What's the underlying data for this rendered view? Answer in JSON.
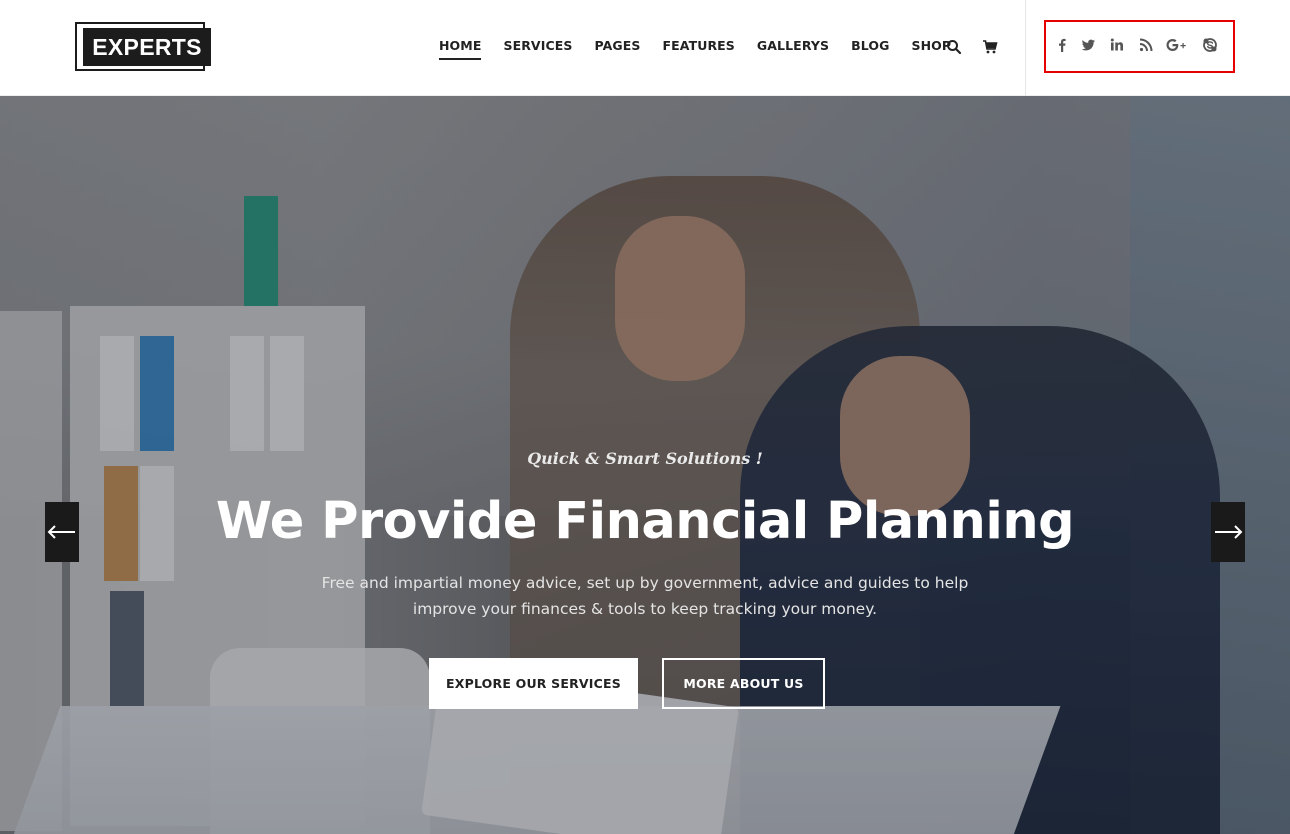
{
  "brand": {
    "logo_text": "EXPERTS"
  },
  "nav": {
    "items": [
      {
        "label": "HOME",
        "active": true
      },
      {
        "label": "SERVICES",
        "active": false
      },
      {
        "label": "PAGES",
        "active": false
      },
      {
        "label": "FEATURES",
        "active": false
      },
      {
        "label": "GALLERYS",
        "active": false
      },
      {
        "label": "BLOG",
        "active": false
      },
      {
        "label": "SHOP",
        "active": false
      }
    ],
    "icons": [
      "search-icon",
      "cart-icon"
    ]
  },
  "social": {
    "icons": [
      "facebook-icon",
      "twitter-icon",
      "linkedin-icon",
      "rss-icon",
      "google-plus-icon",
      "skype-icon"
    ],
    "highlight_color": "#e60000"
  },
  "hero": {
    "subtitle": "Quick & Smart Solutions !",
    "title": "We Provide Financial Planning",
    "description_line1": "Free and impartial money advice, set up by government, advice and guides to help",
    "description_line2": "improve your finances & tools to keep tracking your money.",
    "primary_button": "EXPLORE OUR SERVICES",
    "secondary_button": "MORE ABOUT US",
    "prev_arrow": "⟵",
    "next_arrow": "⟶"
  },
  "colors": {
    "text_dark": "#222222",
    "logo_bg": "#1c1c1c",
    "white": "#ffffff"
  }
}
